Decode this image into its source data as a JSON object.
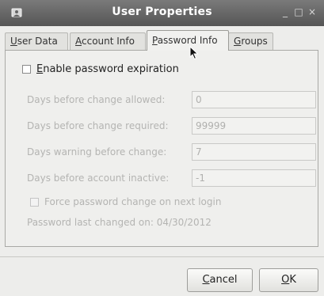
{
  "window": {
    "title": "User Properties",
    "controls": {
      "minimize": "_",
      "maximize": "□",
      "close": "×"
    }
  },
  "tabs": [
    {
      "label_mn": "U",
      "label_rest": "ser Data",
      "active": false
    },
    {
      "label_mn": "A",
      "label_rest": "ccount Info",
      "active": false
    },
    {
      "label_mn": "P",
      "label_rest": "assword Info",
      "active": true
    },
    {
      "label_mn": "G",
      "label_rest": "roups",
      "active": false
    }
  ],
  "password": {
    "enable_expiration": {
      "mn": "E",
      "rest": "nable password expiration",
      "checked": false
    },
    "fields": [
      {
        "label": "Days before change allowed:",
        "value": "0"
      },
      {
        "label": "Days before change required:",
        "value": "99999"
      },
      {
        "label": "Days warning before change:",
        "value": "7"
      },
      {
        "label": "Days before account inactive:",
        "value": "-1"
      }
    ],
    "force_change": {
      "label": "Force password change on next login",
      "checked": false
    },
    "last_changed": "Password last changed on: 04/30/2012"
  },
  "buttons": {
    "cancel": {
      "mn": "C",
      "rest": "ancel"
    },
    "ok": {
      "mn": "O",
      "rest": "K"
    }
  }
}
